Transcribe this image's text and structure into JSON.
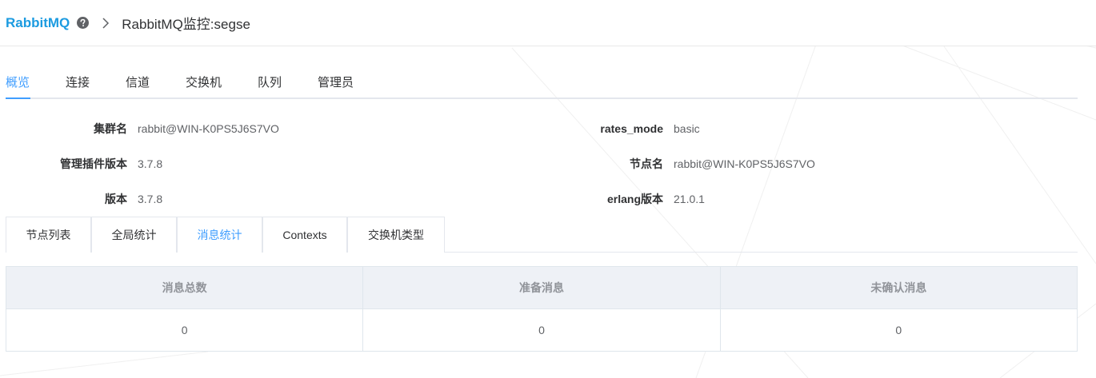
{
  "header": {
    "brand": "RabbitMQ",
    "breadcrumb": "RabbitMQ监控:segse"
  },
  "main_tabs": [
    "概览",
    "连接",
    "信道",
    "交换机",
    "队列",
    "管理员"
  ],
  "main_tabs_active": "概览",
  "overview": {
    "left": [
      {
        "label": "集群名",
        "value": "rabbit@WIN-K0PS5J6S7VO"
      },
      {
        "label": "管理插件版本",
        "value": "3.7.8"
      },
      {
        "label": "版本",
        "value": "3.7.8"
      }
    ],
    "right": [
      {
        "label": "rates_mode",
        "value": "basic"
      },
      {
        "label": "节点名",
        "value": "rabbit@WIN-K0PS5J6S7VO"
      },
      {
        "label": "erlang版本",
        "value": "21.0.1"
      }
    ]
  },
  "sub_tabs": [
    "节点列表",
    "全局统计",
    "消息统计",
    "Contexts",
    "交换机类型"
  ],
  "sub_tabs_active": "消息统计",
  "message_stats": {
    "headers": [
      "消息总数",
      "准备消息",
      "未确认消息"
    ],
    "values": [
      "0",
      "0",
      "0"
    ]
  },
  "colors": {
    "brand": "#1c9be0",
    "accent": "#409eff",
    "table_header_bg": "#eef1f6"
  },
  "icons": {
    "help": "question-circle-icon",
    "separator": "chevron-right-icon"
  }
}
